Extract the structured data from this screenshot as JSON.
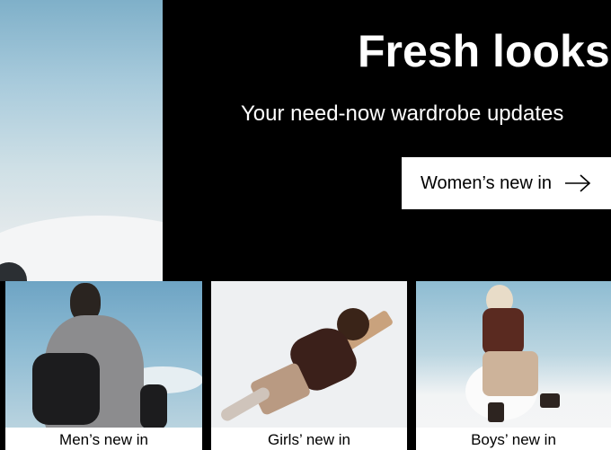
{
  "hero": {
    "title": "Fresh looks",
    "subtitle": "Your need-now wardrobe updates",
    "cta_label": "Women’s new in",
    "cta_icon": "arrow-right-icon"
  },
  "tiles": [
    {
      "label": "Men’s new in"
    },
    {
      "label": "Girls’ new in"
    },
    {
      "label": "Boys’ new in"
    }
  ]
}
